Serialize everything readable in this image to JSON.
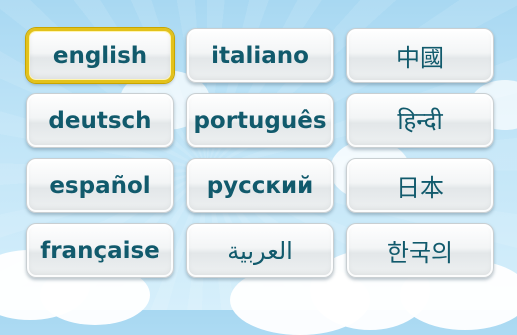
{
  "languages": [
    {
      "label": "english",
      "selected": true
    },
    {
      "label": "italiano"
    },
    {
      "label": "中國"
    },
    {
      "label": "deutsch"
    },
    {
      "label": "português"
    },
    {
      "label": "हिन्दी"
    },
    {
      "label": "español"
    },
    {
      "label": "русский"
    },
    {
      "label": "日本"
    },
    {
      "label": "française"
    },
    {
      "label": "العربية"
    },
    {
      "label": "한국의"
    }
  ],
  "colors": {
    "text": "#115a6c",
    "selected_border": "#e3c21b",
    "sky": "#bfe4f7"
  }
}
